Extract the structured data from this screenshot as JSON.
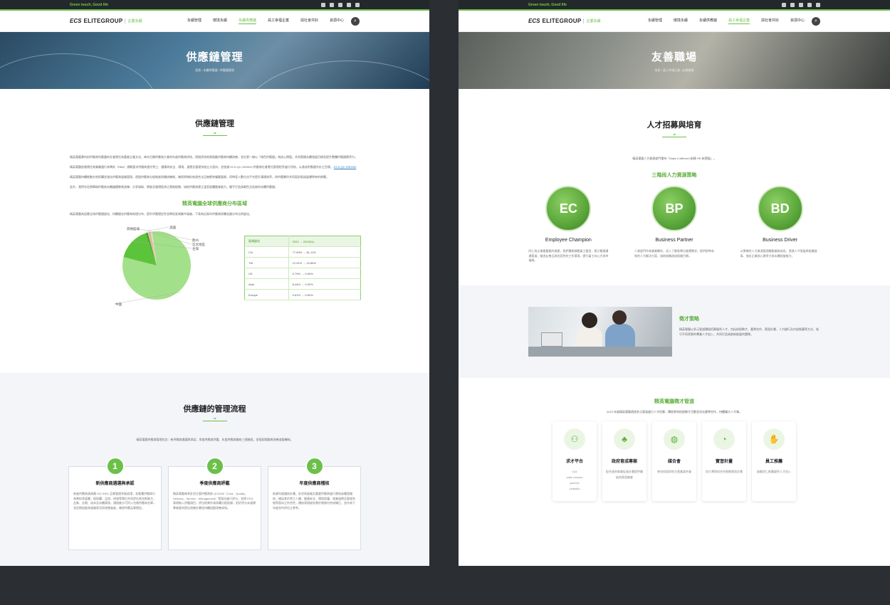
{
  "left": {
    "topbar": {
      "tagline": "Green touch, Good life"
    },
    "nav": {
      "logo_mark": "ECS",
      "logo_name": "ELITEGROUP",
      "logo_sub": "企業永續",
      "items": [
        "永續管理",
        "環境永續",
        "永續供應鏈",
        "員工幸福企業",
        "與社會共好",
        "資源中心"
      ]
    },
    "hero": {
      "title": "供應鏈管理",
      "breadcrumb": "首頁 / 永續供應鏈 / 供應鏈管理"
    },
    "section1": {
      "title": "供應鏈管理",
      "paragraphs": [
        "精英電腦秉持對供應商所應盡的社會責任為重要企業文化，每年召開供應商大會與年度供應商評核，透過評核結果鼓勵供應商持續改善，並在第一線以「綠色供應鏈」為核心價值，共同實踐永續發展目標並提升整體供應鏈競爭力。",
        "精英電腦依循責任商業聯盟行為準則（RBA）規範要求供應商遵守勞工、健康與安全、環境、道德及管理系統五大面向，並依據 ECS-QC-SR0000 供應商社會責任管理程序進行評核，以達成供應鏈共好之目標。",
        "精英電腦持續推動在地採購並強化供應商風險管理，透過供應商分級制度與稽核機制，確保原物料來源合法且無衝突礦產疑慮，同時導入數位化平台提升溝通效率，與供應夥伴共同面對氣候變遷帶來的挑戰。",
        "此外，我們亦定期舉辦供應商永續議題教育訓練，分享減碳、節能及循環經濟之實務經驗，協助供應商建立溫室氣體盤查能力，攜手打造具韌性且低碳的永續供應鏈。"
      ],
      "link_text": "ECS-QC-SR0000",
      "map_title": "精英電腦全球供應商分布區域",
      "map_desc": "精英電腦為因應全球供應鏈變化，持續優化供應商地理分布，提升供應穩定性並降低區域集中風險，下表為近兩年供應商採購金額分布比例變化。"
    },
    "chart_data": {
      "type": "pie",
      "categories": [
        "中國",
        "台灣",
        "亞太地區",
        "歐州",
        "美國",
        "其他區域"
      ],
      "values": [
        81.11,
        15.86,
        0.92,
        0.6,
        0.6,
        0.91
      ],
      "colors": [
        "#a3e08a",
        "#5cc43a",
        "#3f9e2b",
        "#f1c59a",
        "#cfa98a",
        "#e8d6c9"
      ],
      "labels": {
        "china": "中國",
        "taiwan": "台灣",
        "asia": "亞太地區",
        "europe": "歐州",
        "us": "美國",
        "other": "其他區域"
      }
    },
    "table": {
      "headers": [
        "區域變化",
        "2022 → 2023(%)"
      ],
      "rows": [
        [
          "CN",
          "77.69% → 81.11%"
        ],
        [
          "TW",
          "12.51% → 15.86%"
        ],
        [
          "US",
          "0.79% → 0.60%"
        ],
        [
          "Asia",
          "8.44% → 0.92%"
        ],
        [
          "Europe",
          "0.61% → 0.60%"
        ]
      ]
    },
    "section2": {
      "title": "供應鏈的管理流程",
      "intro": "精英電腦供應商管理包含：新供應商遴選與承認、季度供應商評鑑、年度供應商稽核三個階段，並搭配獎勵與改善追蹤機制。",
      "steps": [
        {
          "num": "1",
          "title": "新供應商遴選與承認",
          "text": "新進供應商須具備 ISO 9001 品質管理系統認證，並簽署供應商行為準則承諾書，經採購、品保、研發等單位共同評估其技術能力、品質、交期、成本及永續表現，通過後方可列入合格供應商名單，並定期追蹤其風險狀況與改善進度，確保供應品質穩定。"
        },
        {
          "num": "2",
          "title": "季度供應商評鑑",
          "text": "精英電腦每季針對主要供應商依 QCDSM（Cost、Quality、Delivery、Service、Management）等面向進行評分，並將 ESG 表現納入評鑑項目，評比結果作為採購分配依據，對於評分未達標準者要求提出改善計畫並持續追蹤改善成效。"
        },
        {
          "num": "3",
          "title": "年度供應商稽核",
          "text": "依據年度稽核計畫，針對高風險及重要供應商進行實地或書面稽核，確認其於勞工人權、健康安全、環境保護、商業道德及管理系統等面向之符合性，稽核發現缺失需於期限內完成矯正，並作為下年度合作評估之參考。"
        }
      ]
    }
  },
  "right": {
    "topbar": {
      "tagline": "Green touch, Good life"
    },
    "nav": {
      "logo_mark": "ECS",
      "logo_name": "ELITEGROUP",
      "logo_sub": "企業永續",
      "items": [
        "永續管理",
        "環境永續",
        "永續供應鏈",
        "員工幸福企業",
        "與社會共好",
        "資源中心"
      ]
    },
    "hero": {
      "title": "友善職場",
      "breadcrumb": "首頁 / 員工幸福企業 / 友善職場"
    },
    "section1": {
      "title": "人才招募與培育",
      "intro": "精英電腦人力資源部門秉持「Make it different 創建 HR 新價值」。",
      "strategy_title": "三階段人力資源策略",
      "badges": [
        {
          "abbr": "EC",
          "name": "Employee Champion",
          "text": "同仁為企業最重要的資產，我們積極傾聽員工聲音，建立暢通溝通管道，營造友善且具包容性的工作環境，提升員工向心力與幸福感。"
        },
        {
          "abbr": "BP",
          "name": "Business Partner",
          "text": "人資部門作為事業夥伴，深入了解各單位營運需求，提供即時有效的人力解決方案，協助組織達成經營目標。"
        },
        {
          "abbr": "BD",
          "name": "Business Driver",
          "text": "以策略性人力資源管理驅動業務成長，透過人才發展與組織變革，強化企業核心競爭力與永續經營能力。"
        }
      ]
    },
    "mentor": {
      "title": "徵才策略",
      "text": "精英電腦以多元管道積極招募優秀人才，包括校園徵才、產學合作、實習計畫、人力銀行及內部推薦等方式，吸引不同背景的專業人才加入，共同打造具創新能量的團隊。"
    },
    "section2": {
      "title": "精英電腦徵才管道",
      "intro": "2023 年度精英電腦透過多元管道進行人才招募，積極參與校園徵才活動並深化產學合作，持續擴大人才庫。",
      "tiles": [
        {
          "title": "求才平台",
          "lines": [
            "104",
            "cake resume",
            "yes123",
            "LinkedIn"
          ],
          "icon": "person-icon"
        },
        {
          "title": "政府育成專案",
          "lines": [
            "配合政府就業促進計畫提供職缺與實習機會"
          ],
          "icon": "sprout-icon"
        },
        {
          "title": "媒合會",
          "lines": [
            "參與校園與地方就業媒合會"
          ],
          "icon": "globe-icon"
        },
        {
          "title": "實習計畫",
          "lines": [
            "與大專院校合作推動實習計畫"
          ],
          "icon": "gauge-icon"
        },
        {
          "title": "員工推薦",
          "lines": [
            "鼓勵同仁推薦優秀人才加入"
          ],
          "icon": "handshake-icon"
        }
      ]
    }
  }
}
